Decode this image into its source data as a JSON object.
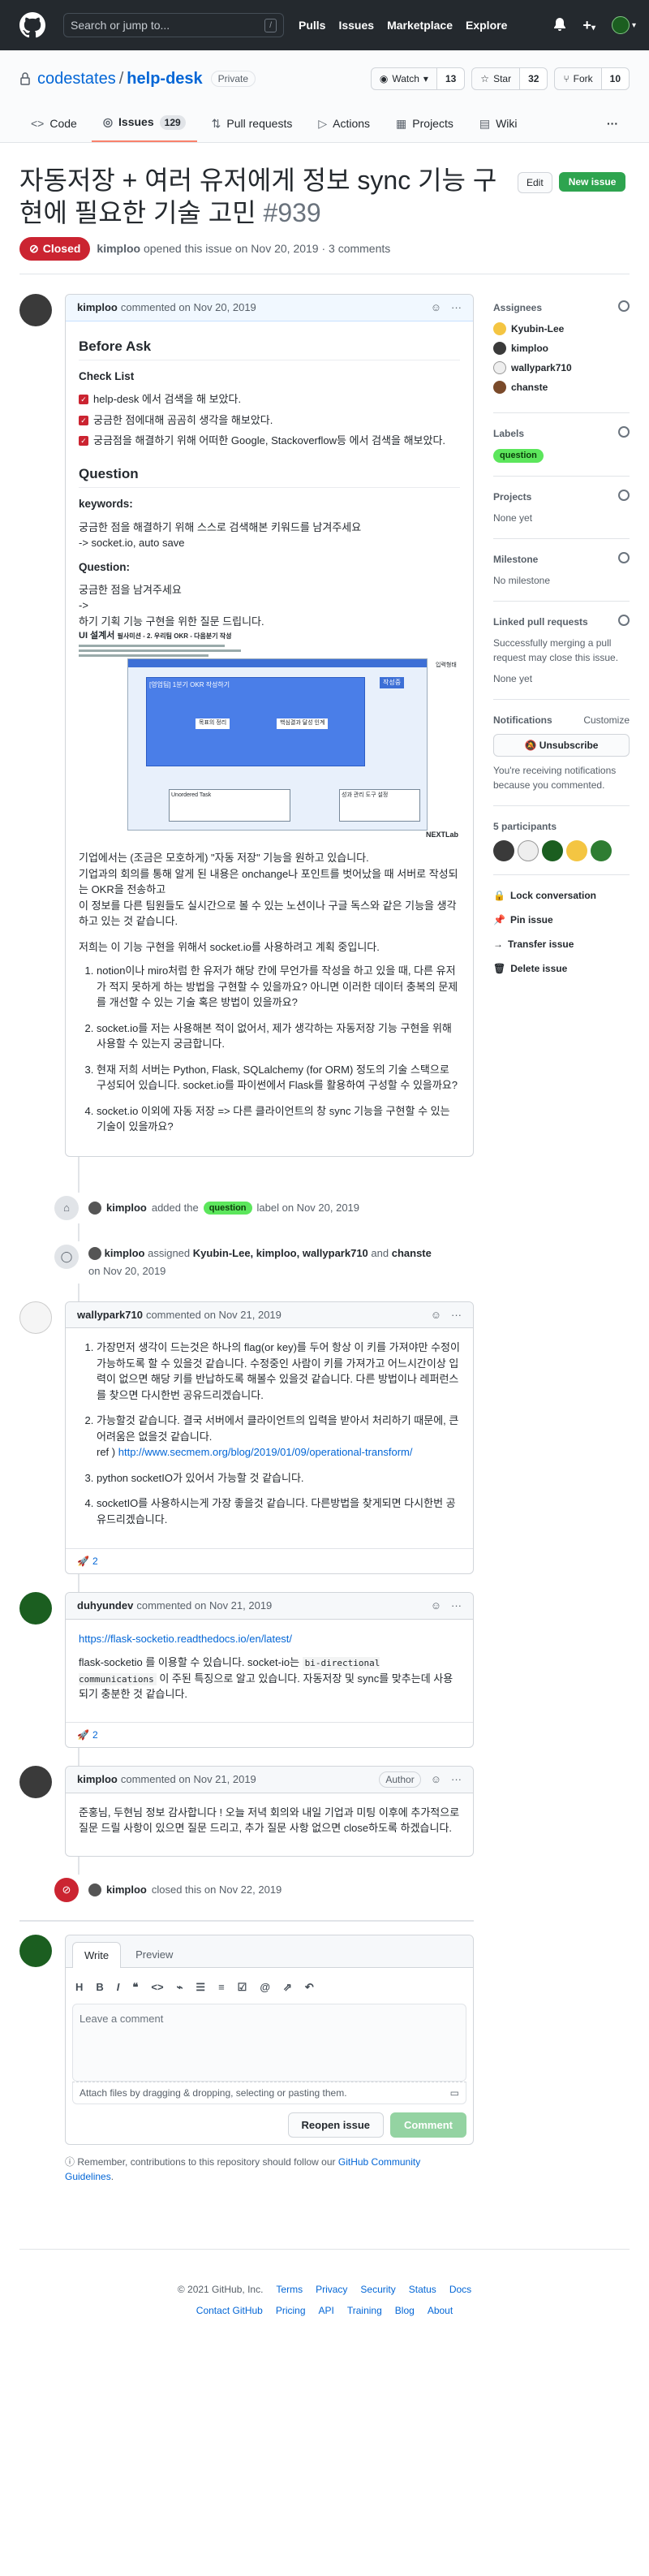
{
  "header": {
    "search_placeholder": "Search or jump to...",
    "slash_key": "/",
    "nav": [
      "Pulls",
      "Issues",
      "Marketplace",
      "Explore"
    ],
    "plus_label": "+"
  },
  "repo": {
    "owner": "codestates",
    "name": "help-desk",
    "visibility": "Private",
    "watch_label": "Watch",
    "watch_count": "13",
    "star_label": "Star",
    "star_count": "32",
    "fork_label": "Fork",
    "fork_count": "10",
    "tabs": [
      {
        "label": "Code"
      },
      {
        "label": "Issues",
        "count": "129"
      },
      {
        "label": "Pull requests"
      },
      {
        "label": "Actions"
      },
      {
        "label": "Projects"
      },
      {
        "label": "Wiki"
      }
    ],
    "more": "···"
  },
  "issue": {
    "title": "자동저장 + 여러 유저에게 정보 sync 기능 구현에 필요한 기술 고민",
    "number": "#939",
    "edit_label": "Edit",
    "new_issue_label": "New issue",
    "state": "Closed",
    "author": "kimploo",
    "meta": "opened this issue on Nov 20, 2019 · 3 comments"
  },
  "comments": {
    "first": {
      "author": "kimploo",
      "when": "commented on Nov 20, 2019",
      "before_ask": "Before Ask",
      "check_list": "Check List",
      "checks": [
        "help-desk 에서 검색을 해 보았다.",
        "궁금한 점에대해 곰곰히 생각을 해보았다.",
        "궁금점을 해결하기 위해 어떠한 Google, Stackoverflow등 에서 검색을 해보았다."
      ],
      "question": "Question",
      "keywords_h": "keywords:",
      "keywords_p1": "궁금한 점을 해결하기 위해 스스로 검색해본 키워드를 남겨주세요",
      "keywords_p2": "-> socket.io, auto save",
      "question_h": "Question:",
      "question_p1": "궁금한 점을 남겨주세요",
      "question_p2": "->",
      "question_p3": "하기 기획 기능 구현을 위한 질문 드립니다.",
      "img_title": "UI 설계서",
      "img_subtitle": "필사미션 - 2. 우리팀 OKR - 다음분기 작성",
      "img_pane_title": "[영업팀] 1분기 OKR 작성하기",
      "img_btn1": "목표의 정리",
      "img_btn2": "핵심결과 달성 인계",
      "img_btn3": "작성중",
      "img_box_title": "Unordered Task",
      "img_side_title": "성과 관리 도구 설정",
      "img_side_title2": "입력형태",
      "img_brand": "NEXTLab",
      "p4": "기업에서는 (조금은 모호하게) \"자동 저장\" 기능을 원하고 있습니다.",
      "p5": "기업과의 회의를 통해 알게 된 내용은 onchange나 포인트를 벗어났을 때 서버로 작성되는 OKR을 전송하고",
      "p6": "이 정보를 다른 팀원들도 실시간으로 볼 수 있는 노션이나 구글 독스와 같은 기능을 생각하고 있는 것 같습니다.",
      "p7": "저희는 이 기능 구현을 위해서 socket.io를 사용하려고 계획 중입니다.",
      "list": [
        "notion이나 miro처럼 한 유저가 해당 칸에 무언가를 작성을 하고 있을 때, 다른 유저가 적지 못하게 하는 방법을 구현할 수 있을까요? 아니면 이러한 데이터 충복의 문제를 개선할 수 있는 기술 혹은 방법이 있을까요?",
        "socket.io를 저는 사용해본 적이 없어서, 제가 생각하는 자동저장 기능 구현을 위해 사용할 수 있는지 궁금합니다.",
        "현재 저희 서버는 Python, Flask, SQLalchemy (for ORM) 정도의 기술 스택으로 구성되어 있습니다. socket.io를 파이썬에서 Flask를 활용하여 구성할 수 있을까요?",
        "socket.io 이외에 자동 저장 => 다른 클라이언트의 창 sync 기능을 구현할 수 있는 기술이 있을까요?"
      ]
    },
    "event1": {
      "actor": "kimploo",
      "pre": "added the",
      "label": "question",
      "post": "label on Nov 20, 2019"
    },
    "event2": {
      "actor": "kimploo",
      "text_pre": "assigned",
      "names": "Kyubin-Lee, kimploo, wallypark710",
      "and": "and",
      "last": "chanste",
      "date": "on Nov 20, 2019"
    },
    "second": {
      "author": "wallypark710",
      "when": "commented on Nov 21, 2019",
      "list": [
        "가장먼저 생각이 드는것은 하나의 flag(or key)를 두어 항상 이 키를 가져야만 수정이 가능하도록 할 수 있을것 같습니다. 수정중인 사람이 키를 가져가고 어느시간이상 입력이 없으면 해당 키를 반납하도록 해볼수 있을것 같습니다. 다른 방법이나 레퍼런스를 찾으면 다시한번 공유드리겠습니다.",
        "가능할것 같습니다. 결국 서버에서 클라이언트의 입력을 받아서 처리하기 때문에, 큰 어려움은 없을것 같습니다.",
        "python socketIO가 있어서 가능할 것 같습니다.",
        "socketIO를 사용하시는게 가장 좋을것 같습니다. 다른방법을 찾게되면 다시한번 공유드리겠습니다."
      ],
      "ref_prefix": "ref )",
      "ref_link": "http://www.secmem.org/blog/2019/01/09/operational-transform/",
      "reaction": "2"
    },
    "third": {
      "author": "duhyundev",
      "when": "commented on Nov 21, 2019",
      "link": "https://flask-socketio.readthedocs.io/en/latest/",
      "p_pre": "flask-socketio 를 이용할 수 있습니다. socket-io는",
      "code": "bi-directional communications",
      "p_post": "이 주된 특징으로 알고 있습니다. 자동저장 및 sync를 맞추는데 사용되기 충분한 것 같습니다.",
      "reaction": "2"
    },
    "fourth": {
      "author": "kimploo",
      "when": "commented on Nov 21, 2019",
      "badge": "Author",
      "text": "준홍님, 두현님 정보 감사합니다 ! 오늘 저녁 회의와 내일 기업과 미팅 이후에 추가적으로 질문 드릴 사항이 있으면 질문 드리고, 추가 질문 사항 없으면 close하도록 하겠습니다."
    },
    "closed_event": {
      "actor": "kimploo",
      "text": "closed this on Nov 22, 2019"
    }
  },
  "editor": {
    "write": "Write",
    "preview": "Preview",
    "placeholder": "Leave a comment",
    "attach": "Attach files by dragging & dropping, selecting or pasting them.",
    "reopen": "Reopen issue",
    "comment": "Comment",
    "tip_pre": "Remember, contributions to this repository should follow our",
    "tip_link": "GitHub Community Guidelines",
    "tip_post": "."
  },
  "sidebar": {
    "assignees_title": "Assignees",
    "assignees": [
      "Kyubin-Lee",
      "kimploo",
      "wallypark710",
      "chanste"
    ],
    "labels_title": "Labels",
    "label": "question",
    "projects_title": "Projects",
    "projects_value": "None yet",
    "milestone_title": "Milestone",
    "milestone_value": "No milestone",
    "linked_title": "Linked pull requests",
    "linked_desc": "Successfully merging a pull request may close this issue.",
    "linked_value": "None yet",
    "notifications_title": "Notifications",
    "customize": "Customize",
    "unsubscribe": "Unsubscribe",
    "notif_desc": "You're receiving notifications because you commented.",
    "participants_title": "5 participants",
    "actions": [
      "Lock conversation",
      "Pin issue",
      "Transfer issue",
      "Delete issue"
    ]
  },
  "footer": {
    "copyright": "© 2021 GitHub, Inc.",
    "row1": [
      "Terms",
      "Privacy",
      "Security",
      "Status",
      "Docs"
    ],
    "row2": [
      "Contact GitHub",
      "Pricing",
      "API",
      "Training",
      "Blog",
      "About"
    ]
  },
  "colors": {
    "closed": "#cb2431",
    "label": "#5ce65c",
    "link": "#0366d6",
    "header": "#24292e"
  }
}
